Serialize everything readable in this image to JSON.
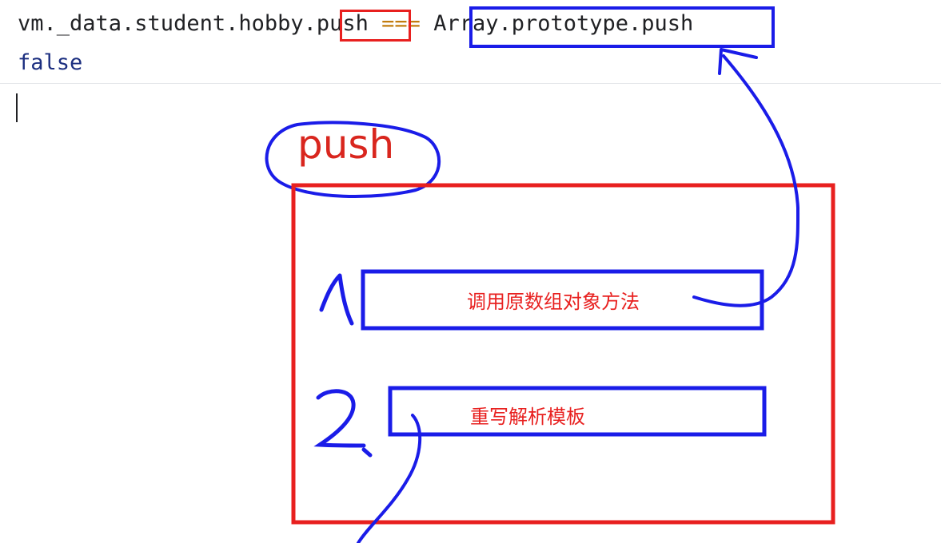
{
  "console": {
    "input": {
      "prefix": "vm._data.student.hobby.",
      "method": "push",
      "operator": " === ",
      "rhs": "Array.prototype.push"
    },
    "output": "false"
  },
  "annotation": {
    "label": "push",
    "steps": [
      {
        "number": "1.",
        "text": "调用原数组对象方法"
      },
      {
        "number": "2.",
        "text": "重写解析模板"
      }
    ],
    "colors": {
      "red": "#e8201f",
      "blue": "#1a1ce8"
    }
  }
}
